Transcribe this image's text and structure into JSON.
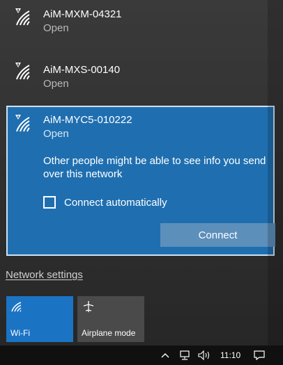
{
  "networks": [
    {
      "name": "AiM-MXM-04321",
      "status": "Open",
      "icon": "wifi-open-icon"
    },
    {
      "name": "AiM-MXS-00140",
      "status": "Open",
      "icon": "wifi-open-icon"
    }
  ],
  "selected": {
    "name": "AiM-MYC5-010222",
    "status": "Open",
    "icon": "wifi-open-icon",
    "warning": "Other people might be able to see info you send over this network",
    "connect_auto_label": "Connect automatically",
    "connect_auto_checked": false,
    "connect_label": "Connect"
  },
  "network_settings_label": "Network settings",
  "quick_actions": [
    {
      "label": "Wi-Fi",
      "icon": "wifi-icon",
      "active": true
    },
    {
      "label": "Airplane mode",
      "icon": "airplane-icon",
      "active": false
    }
  ],
  "taskbar": {
    "time": "11:10",
    "icons": [
      "chevron-up-icon",
      "network-icon",
      "volume-icon",
      "notification-icon"
    ]
  },
  "colors": {
    "accent": "#1f6fb0",
    "tile_active": "#1b73c4",
    "connect_button": "#5d8fbb"
  }
}
